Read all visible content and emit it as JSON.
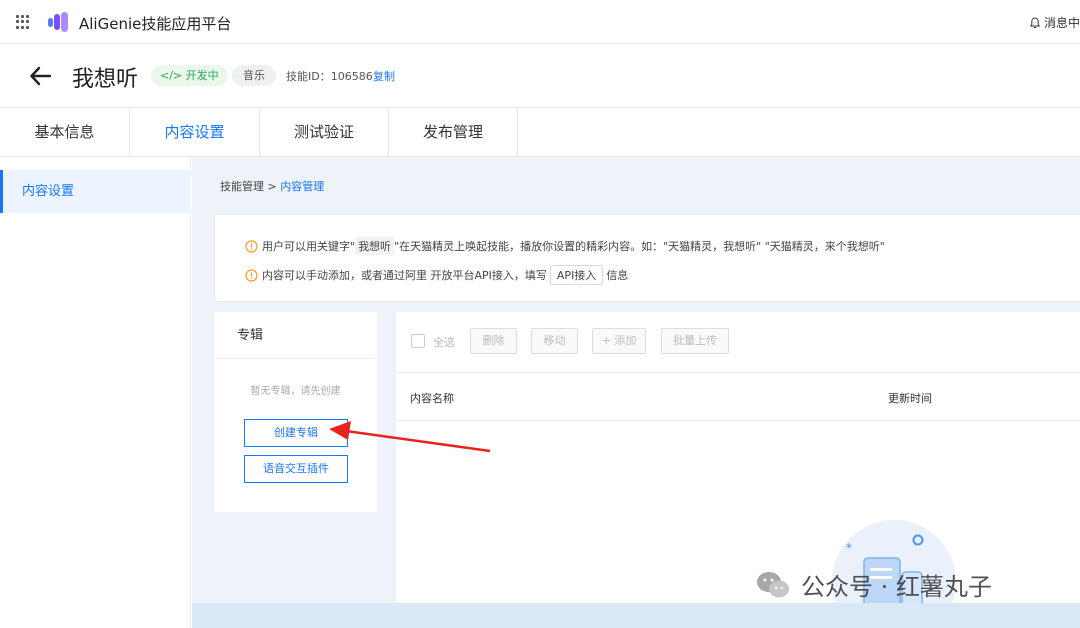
{
  "app": {
    "title": "AliGenie技能应用平台",
    "notice": "消息中"
  },
  "header": {
    "skill_name": "我想听",
    "status": "开发中",
    "category": "音乐",
    "skill_id": "技能ID：106586",
    "copy_label": "复制"
  },
  "tabs": [
    {
      "label": "基本信息"
    },
    {
      "label": "内容设置"
    },
    {
      "label": "测试验证"
    },
    {
      "label": "发布管理"
    }
  ],
  "sidebar": {
    "items": [
      {
        "label": "内容设置"
      }
    ]
  },
  "breadcrumb": {
    "parent": "技能管理",
    "sep": ">",
    "current": "内容管理"
  },
  "tips": {
    "line1_pre": "用户可以用关键字",
    "line1_kw": "我想听",
    "line1_post": "\"在天猫精灵上唤起技能，播放你设置的精彩内容。如：\"天猫精灵，我想听\" \"天猫精灵，来个我想听\"",
    "line2_pre": "内容可以手动添加，或者通过阿里 开放平台API接入，填写",
    "line2_tag": "API接入",
    "line2_post": "信息"
  },
  "album": {
    "title": "专辑",
    "empty": "暂无专辑，请先创建",
    "create_button": "创建专辑",
    "plugin_button": "语音交互插件"
  },
  "toolbar": {
    "select_all": "全选",
    "delete": "删除",
    "move": "移动",
    "add": "+ 添加",
    "batch_upload": "批量上传"
  },
  "table": {
    "columns": [
      "内容名称",
      "更新时间"
    ]
  },
  "watermark": "公众号 · 红薯丸子",
  "colors": {
    "accent": "#1677ff",
    "status_green": "#2aa653",
    "annotation_red": "#e8231f"
  }
}
